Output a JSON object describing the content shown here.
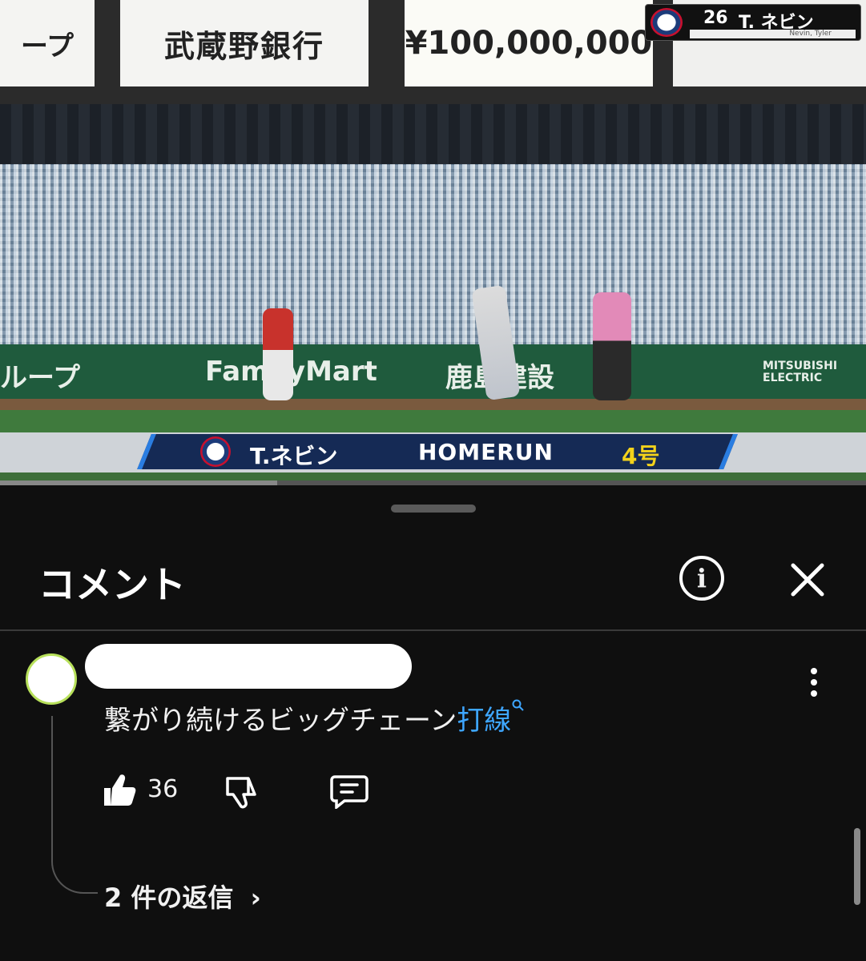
{
  "video": {
    "ads": [
      "ープ",
      "武蔵野銀行",
      "¥100,000,000",
      ""
    ],
    "wall_ads": [
      "ループ",
      "FamilyMart",
      "鹿島建設",
      "MITSUBISHI ELECTRIC"
    ],
    "scorebug": {
      "number": "26",
      "player": "T. ネビン",
      "sub": "Nevin, Tyler"
    },
    "lower_third": {
      "player": "T.ネビン",
      "event": "HOMERUN",
      "count": "4号"
    },
    "progress_fraction": 0.32
  },
  "comments": {
    "title": "コメント",
    "info_icon": "info-icon",
    "close_icon": "close-icon",
    "items": [
      {
        "username": "",
        "text": "繋がり続けるビッグチェーン",
        "link_text": "打線",
        "likes": "36",
        "replies_label": "2 件の返信"
      }
    ]
  },
  "colors": {
    "link": "#3ea6ff",
    "background": "#0f0f0f",
    "brand_navy": "#152a55",
    "count_yellow": "#f3d21b"
  }
}
